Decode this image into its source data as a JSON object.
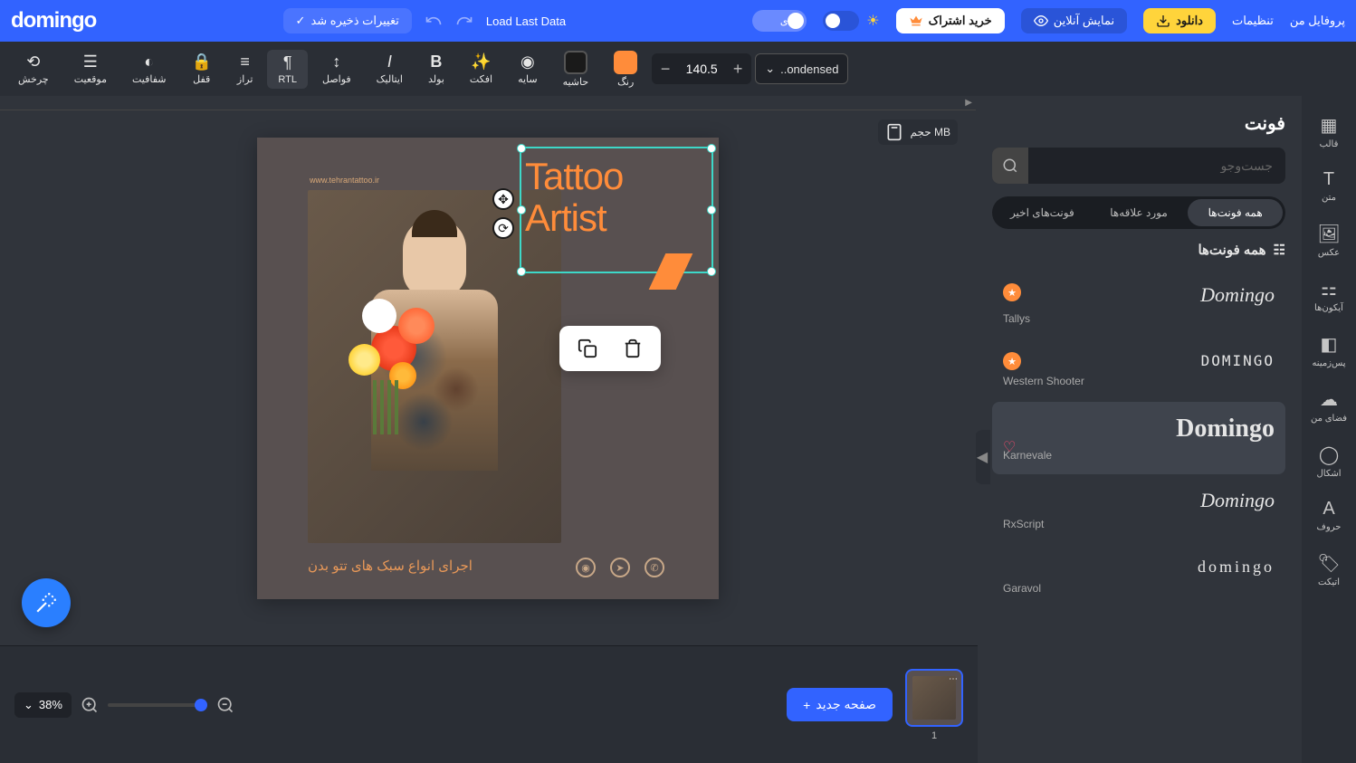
{
  "header": {
    "logo": "domingo",
    "profile": "پروفایل من",
    "settings": "تنظیمات",
    "download": "دانلود",
    "online_preview": "نمایش آنلاین",
    "subscribe": "خرید اشتراک",
    "mode_normal": "عادی",
    "load_last": "Load Last Data",
    "save_changes": "تغییرات ذخیره شد"
  },
  "toolbar": {
    "rotate": "چرخش",
    "position": "موقعیت",
    "opacity": "شفافیت",
    "lock": "قفل",
    "align": "تراز",
    "rtl": "RTL",
    "spacing": "فواصل",
    "italic": "ایتالیک",
    "bold": "بولد",
    "effect": "افکت",
    "shadow": "سایه",
    "border": "حاشیه",
    "color": "رنگ",
    "font_size": "140.5",
    "font_name": "..ondensed"
  },
  "sidebar": {
    "template": "قالب",
    "text": "متن",
    "image": "عکس",
    "icons": "آیکون‌ها",
    "background": "پس‌زمینه",
    "myspace": "فضای من",
    "shapes": "اشکال",
    "letters": "حروف",
    "tag": "اتیکت"
  },
  "panel": {
    "title": "فونت",
    "search_placeholder": "جست‌وجو",
    "tabs": {
      "all": "همه فونت‌ها",
      "fav": "مورد علاقه‌ها",
      "recent": "فونت‌های اخیر"
    },
    "section": "همه فونت‌ها",
    "fonts": [
      {
        "preview": "Domingo",
        "name": "Tallys",
        "badge": true
      },
      {
        "preview": "DOMINGO",
        "name": "Western Shooter",
        "badge": true
      },
      {
        "preview": "Domingo",
        "name": "Karnevale",
        "selected": true,
        "heart": true
      },
      {
        "preview": "Domingo",
        "name": "RxScript"
      },
      {
        "preview": "domingo",
        "name": "Garavol"
      }
    ]
  },
  "canvas": {
    "size_label": "حجم MB",
    "url": "www.tehrantattoo.ir",
    "main_text": "Tattoo\nArtist",
    "caption": "اجرای انواع سبک های تتو بدن"
  },
  "bottom": {
    "zoom": "38%",
    "new_page": "صفحه جدید",
    "page_num": "1"
  }
}
